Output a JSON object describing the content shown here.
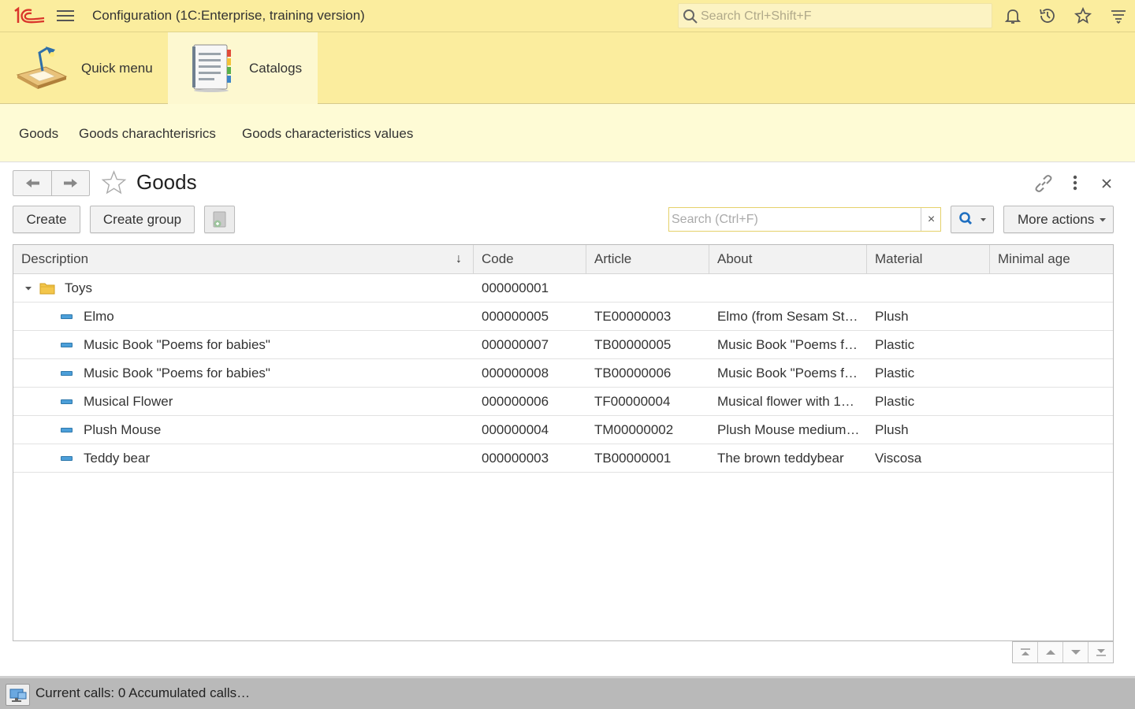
{
  "app": {
    "title": "Configuration  (1C:Enterprise, training version)",
    "search_placeholder": "Search Ctrl+Shift+F"
  },
  "sections": [
    {
      "label": "Quick menu"
    },
    {
      "label": "Catalogs"
    }
  ],
  "function_panel": {
    "links": [
      "Goods",
      "Goods charachterisrics",
      "Goods characteristics values"
    ]
  },
  "form": {
    "title": "Goods",
    "create_label": "Create",
    "create_group_label": "Create group",
    "search_placeholder": "Search (Ctrl+F)",
    "clear_label": "×",
    "more_actions_label": "More actions"
  },
  "table": {
    "columns": [
      "Description",
      "Code",
      "Article",
      "About",
      "Material",
      "Minimal age"
    ],
    "group": {
      "description": "Toys",
      "code": "000000001"
    },
    "rows": [
      {
        "description": "Elmo",
        "code": "000000005",
        "article": "TE00000003",
        "about": "Elmo (from Sesam St…",
        "material": "Plush",
        "minimal_age": ""
      },
      {
        "description": "Music Book \"Poems for babies\"",
        "code": "000000007",
        "article": "TB00000005",
        "about": "Music Book \"Poems f…",
        "material": "Plastic",
        "minimal_age": ""
      },
      {
        "description": "Music Book \"Poems for babies\"",
        "code": "000000008",
        "article": "TB00000006",
        "about": "Music Book \"Poems f…",
        "material": "Plastic",
        "minimal_age": ""
      },
      {
        "description": "Musical Flower",
        "code": "000000006",
        "article": "TF00000004",
        "about": "Musical flower with 1…",
        "material": "Plastic",
        "minimal_age": ""
      },
      {
        "description": "Plush Mouse",
        "code": "000000004",
        "article": "TM00000002",
        "about": "Plush Mouse medium…",
        "material": "Plush",
        "minimal_age": ""
      },
      {
        "description": "Teddy bear",
        "code": "000000003",
        "article": "TB00000001",
        "about": "The brown teddybear",
        "material": "Viscosa",
        "minimal_age": ""
      }
    ]
  },
  "status": {
    "text": "Current calls: 0   Accumulated calls…"
  }
}
